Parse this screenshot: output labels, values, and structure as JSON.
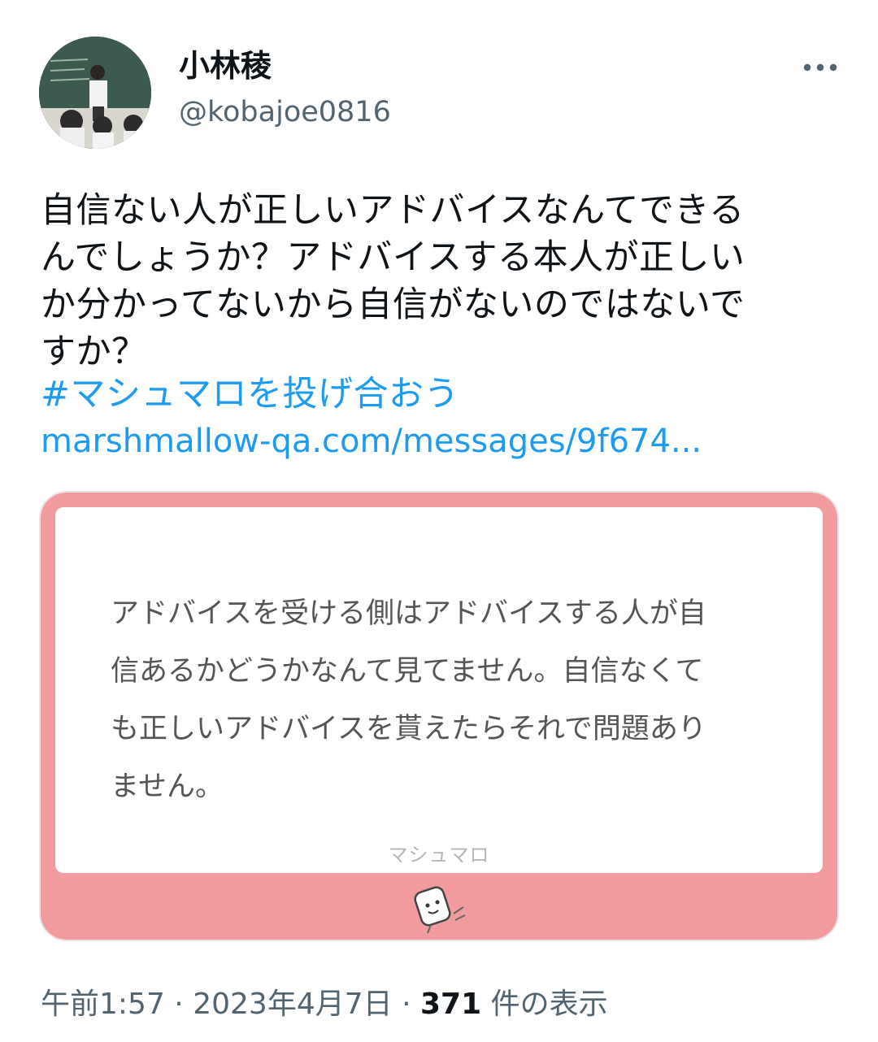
{
  "author": {
    "display_name": "小林稜",
    "handle": "@kobajoe0816"
  },
  "tweet": {
    "text": "自信ない人が正しいアドバイスなんてできる\nんでしょうか？アドバイスする本人が正しい\nか分かってないから自信がないのではないで\nすか？",
    "hashtag": "#マシュマロを投げ合おう",
    "link": "marshmallow-qa.com/messages/9f674..."
  },
  "card": {
    "answer_text": "アドバイスを受ける側はアドバイスする人が自\n信あるかどうかなんて見てません。自信なくて\nも正しいアドバイスを貰えたらそれで問題あり\nません。",
    "brand_label": "マシュマロ"
  },
  "meta": {
    "time": "午前1:57",
    "separator": "·",
    "date": "2023年4月7日",
    "views_count": "371",
    "views_label": "件の表示"
  },
  "colors": {
    "link_blue": "#1d9bf0",
    "card_pink": "#f29b9e",
    "muted_gray": "#536471"
  },
  "icons": [
    "more-options-icon",
    "marshmallow-mascot-icon"
  ]
}
